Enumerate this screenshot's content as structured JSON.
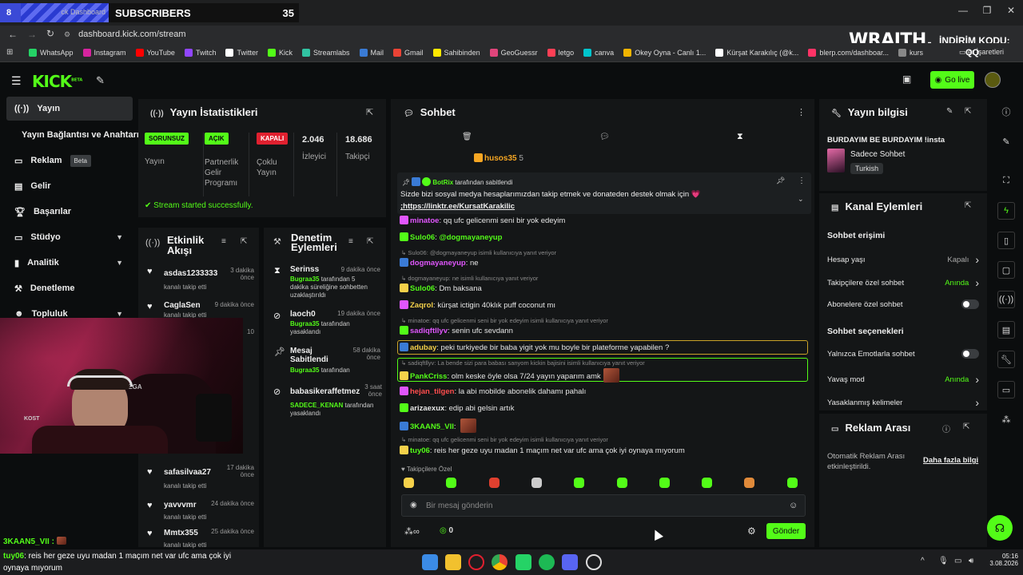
{
  "overlay": {
    "subs_badge": "8",
    "bar_text": "ck Dashboard",
    "subs_label": "SUBSCRIBERS",
    "subs_count": "35",
    "wraith": "WRAITH.",
    "indirim": "İNDİRİM KODU:",
    "code": "QQ"
  },
  "browser": {
    "url": "dashboard.kick.com/stream",
    "bookmarks": [
      {
        "label": "WhatsApp",
        "color": "#25d366"
      },
      {
        "label": "Instagram",
        "color": "#d6249f"
      },
      {
        "label": "YouTube",
        "color": "#ff0000"
      },
      {
        "label": "Twitch",
        "color": "#9146ff"
      },
      {
        "label": "Twitter",
        "color": "#ffffff"
      },
      {
        "label": "Kick",
        "color": "#53fc18"
      },
      {
        "label": "Streamlabs",
        "color": "#31c3a2"
      },
      {
        "label": "Mail",
        "color": "#3a7bd5"
      },
      {
        "label": "Gmail",
        "color": "#ea4335"
      },
      {
        "label": "Sahibinden",
        "color": "#ffe800"
      },
      {
        "label": "GeoGuessr",
        "color": "#e0457b"
      },
      {
        "label": "letgo",
        "color": "#ff3f55"
      },
      {
        "label": "canva",
        "color": "#00c4cc"
      },
      {
        "label": "Okey Oyna - Canlı 1...",
        "color": "#f0b400"
      },
      {
        "label": "Kürşat Karakılıç (@k...",
        "color": "#ffffff"
      },
      {
        "label": "blerp.com/dashboar...",
        "color": "#ff3366"
      },
      {
        "label": "kurs",
        "color": "#888888"
      }
    ],
    "other_bookmarks": "er İşaretleri"
  },
  "header": {
    "logo": "KICK",
    "logo_sup": "BETA",
    "go_live": "Go live"
  },
  "sidebar": {
    "items": [
      {
        "label": "Yayın",
        "icon": "broadcast-icon"
      },
      {
        "label": "Yayın Bağlantısı ve Anahtarı",
        "icon": ""
      },
      {
        "label": "Reklam",
        "icon": "ad-icon",
        "badge": "Beta"
      },
      {
        "label": "Gelir",
        "icon": "revenue-icon"
      },
      {
        "label": "Başarılar",
        "icon": "trophy-icon"
      },
      {
        "label": "Stüdyo",
        "icon": "studio-icon"
      },
      {
        "label": "Analitik",
        "icon": "chart-icon"
      },
      {
        "label": "Denetleme",
        "icon": "hammer-icon"
      },
      {
        "label": "Topluluk",
        "icon": "community-icon"
      }
    ]
  },
  "stats": {
    "title": "Yayın İstatistikleri",
    "cols": [
      {
        "tag": "SORUNSUZ",
        "label": "Yayın"
      },
      {
        "tag": "AÇIK",
        "label": "Partnerlik Gelir Programı"
      },
      {
        "tag": "KAPALI",
        "label": "Çoklu Yayın"
      },
      {
        "value": "2.046",
        "label": "İzleyici"
      },
      {
        "value": "18.686",
        "label": "Takipçi"
      }
    ],
    "success": "Stream started successfully."
  },
  "activity": {
    "title": "Etkinlik Akışı",
    "items": [
      {
        "name": "asdas1233333",
        "sub": "kanalı takip etti",
        "time": "3 dakika önce"
      },
      {
        "name": "CaglaSen",
        "sub": "kanalı takip etti",
        "time": "9 dakika önce"
      },
      {
        "name": "safasilvaa27",
        "sub": "kanalı takip etti",
        "time": "17 dakika önce"
      },
      {
        "name": "yavvvmr",
        "sub": "kanalı takip etti",
        "time": "24 dakika önce"
      },
      {
        "name": "Mmtx355",
        "sub": "kanalı takip etti",
        "time": "25 dakika önce"
      }
    ],
    "hidden_time_fragment": "10"
  },
  "moderation": {
    "title": "Denetim Eylemleri",
    "items": [
      {
        "name": "Serinss",
        "time": "9 dakika önce",
        "by": "Bugraa35",
        "rest": "tarafından 5 dakika süreliğine sohbetten uzaklaştırıldı"
      },
      {
        "name": "laoch0",
        "time": "19 dakika önce",
        "by": "Bugraa35",
        "rest": "tarafından yasaklandı"
      },
      {
        "name": "Mesaj Sabitlendi",
        "time": "58 dakika önce",
        "by": "Bugraa35",
        "rest": "tarafından"
      },
      {
        "name": "babasikeraffetmez",
        "time": "3 saat önce",
        "by": "SADECE_KENAN",
        "rest": "tarafından yasaklandı"
      }
    ]
  },
  "chat": {
    "title": "Sohbet",
    "top_user": "husos35",
    "top_count": "5",
    "pinned_by": "BotRix",
    "pinned_by_rest": "tarafından sabitlendi",
    "pinned_text": "Sizde bizi sosyal medya hesaplarımızdan takip etmek ve donateden destek olmak için 💗",
    "pinned_link": ";https://linktr.ee/KursatKarakilic",
    "messages": [
      {
        "reply": "",
        "user": "minatoe",
        "color": "#e056fd",
        "text": "qq ufc gelicenmi seni bir yok edeyim"
      },
      {
        "reply": "",
        "user": "Sulo06",
        "color": "#53fc18",
        "text": "@dogmayaneyup",
        "text_color": "#53fc18"
      },
      {
        "reply": "Sulo06: @dogmayaneyup isimli kullanıcıya yanıt veriyor",
        "user": "dogmayaneyup",
        "color": "#e056fd",
        "text": "ne"
      },
      {
        "reply": "dogmayaneyup: ne isimli kullanıcıya yanıt veriyor",
        "user": "Sulo06",
        "color": "#53fc18",
        "text": "Dm baksana"
      },
      {
        "reply": "",
        "user": "Zaqrol",
        "color": "#f5d14a",
        "text": "kürşat ictigin 40klık puff coconut mı"
      },
      {
        "reply": "minatoe: qq ufc gelicenmi seni bir yok edeyim isimli kullanıcıya yanıt veriyor",
        "user": "sadiqftllyv",
        "color": "#e056fd",
        "text": "senin ufc sevdann"
      },
      {
        "reply": "",
        "user": "adubay",
        "color": "#f5d14a",
        "text": "peki turkiyede bir baba yigit yok mu boyle bir plateforme yapabilen ?"
      },
      {
        "reply": "sadiqftllyv: La bende sizi para babası sanyom kickin bajisini isimli kullanıcıya yanıt veriyor",
        "user": "PankCriss",
        "color": "#53fc18",
        "text": "olm keske öyle olsa 7/24 yayın yaparım amk"
      },
      {
        "reply": "",
        "user": "hejan_tilgen",
        "color": "#ff4d4d",
        "text": "la abi mobilde abonelik dahamı pahalı"
      },
      {
        "reply": "",
        "user": "arizaexux",
        "color": "#e6e6e6",
        "text": "edip abi gelsin artık"
      },
      {
        "reply": "",
        "user": "3KAAN5_VII",
        "color": "#53fc18",
        "text": ""
      },
      {
        "reply": "minatoe: qq ufc gelicenmi seni bir yok edeyim isimli kullanıcıya yanıt veriyor",
        "user": "tuy06",
        "color": "#53fc18",
        "text": "reis her geze uyu madan 1 maçım net var ufc ama çok iyi oynaya mıyorum"
      }
    ],
    "followers_only": "Takipçilere Özel",
    "input_placeholder": "Bir mesaj gönderin",
    "points": "0",
    "send": "Gönder"
  },
  "stream_info": {
    "title": "Yayın bilgisi",
    "stream_title": "BURDAYIM BE BURDAYIM !insta",
    "category": "Sadece Sohbet",
    "language": "Turkish"
  },
  "channel_actions": {
    "title": "Kanal Eylemleri",
    "chat_access": "Sohbet erişimi",
    "rows1": [
      {
        "label": "Hesap yaşı",
        "value": "Kapalı",
        "value_color": "#a9a9a9",
        "control": "chevron"
      },
      {
        "label": "Takipçilere özel sohbet",
        "value": "Anında",
        "value_color": "#53fc18",
        "control": "chevron"
      },
      {
        "label": "Abonelere özel sohbet",
        "value": "",
        "control": "toggle"
      }
    ],
    "chat_options": "Sohbet seçenekleri",
    "rows2": [
      {
        "label": "Yalnızca Emotlarla sohbet",
        "value": "",
        "control": "toggle"
      },
      {
        "label": "Yavaş mod",
        "value": "Anında",
        "value_color": "#53fc18",
        "control": "chevron"
      },
      {
        "label": "Yasaklanmış kelimeler",
        "value": "",
        "control": "chevron"
      }
    ]
  },
  "ad_break": {
    "title": "Reklam Arası",
    "desc": "Otomatik Reklam Arası etkinleştirildi.",
    "link": "Daha fazla bilgi"
  },
  "overlay_chat": {
    "user": "3KAAN5_VII :",
    "line_user": "tuy06",
    "line_text": ": reis her geze uyu madan 1 maçım net var ufc ama çok iyi oynaya mıyorum"
  },
  "webcam": {
    "sign": "VEGA",
    "shirt": "KOST"
  },
  "clock": {
    "time": "05:16",
    "date": "3.08.2026"
  }
}
